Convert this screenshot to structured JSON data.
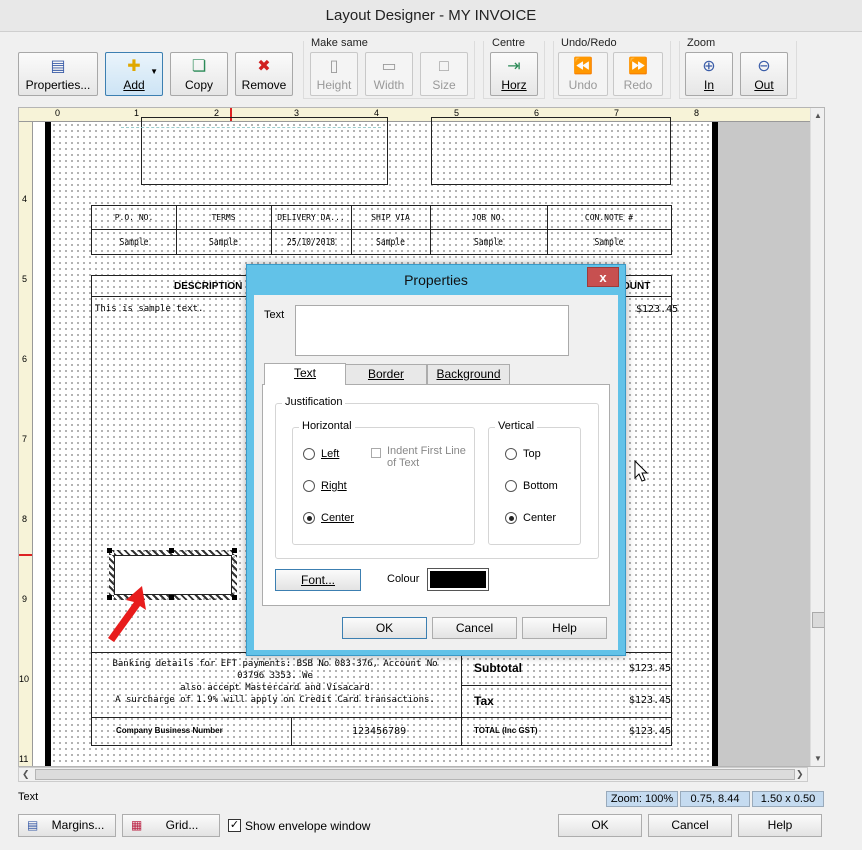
{
  "window": {
    "title": "Layout Designer - MY INVOICE"
  },
  "toolbar": {
    "properties": "Properties...",
    "add": "Add",
    "copy": "Copy",
    "remove": "Remove",
    "make_same_label": "Make same",
    "height": "Height",
    "width": "Width",
    "size": "Size",
    "centre_label": "Centre",
    "horz": "Horz",
    "undo_redo_label": "Undo/Redo",
    "undo": "Undo",
    "redo": "Redo",
    "zoom_label": "Zoom",
    "zoom_in": "In",
    "zoom_out": "Out"
  },
  "ruler": {
    "h": [
      "0",
      "1",
      "2",
      "3",
      "4",
      "5",
      "6",
      "7",
      "8"
    ],
    "v": [
      "4",
      "5",
      "6",
      "7",
      "8",
      "9",
      "10",
      "11"
    ]
  },
  "invoice": {
    "headers": [
      "P.O. NO.",
      "TERMS",
      "DELIVERY DA...",
      "SHIP VIA",
      "JOB NO.",
      "CON.NOTE #"
    ],
    "values": [
      "Sample",
      "Sample",
      "25/10/2018",
      "Sample",
      "Sample",
      "Sample"
    ],
    "description_header": "DESCRIPTION",
    "amount_header": "OUNT",
    "line_text": "This is sample text.",
    "line_amount": "$123.45",
    "bank_line1": "Banking details for EFT payments: BSB No 083-376, Account No 03796 3353. We",
    "bank_line2": "also accept Mastercard and Visacard",
    "bank_line3": "A surcharge of 1.9% will apply on Credit Card transactions.",
    "subtotal_label": "Subtotal",
    "subtotal_value": "$123.45",
    "tax_label": "Tax",
    "tax_value": "$123.45",
    "cbn_label": "Company Business Number",
    "cbn_value": "123456789",
    "total_label": "TOTAL (Inc GST)",
    "total_value": "$123.45"
  },
  "dialog": {
    "title": "Properties",
    "close": "x",
    "text_label": "Text",
    "text_value": "",
    "tabs": [
      "Text",
      "Border",
      "Background"
    ],
    "justification": "Justification",
    "horizontal": "Horizontal",
    "vertical": "Vertical",
    "h_left": "Left",
    "h_right": "Right",
    "h_center": "Center",
    "indent": "Indent First Line of Text",
    "v_top": "Top",
    "v_bottom": "Bottom",
    "v_center": "Center",
    "font_button": "Font...",
    "colour_label": "Colour",
    "colour_value": "#000000",
    "ok": "OK",
    "cancel": "Cancel",
    "help": "Help"
  },
  "status": {
    "left": "Text",
    "zoom": "Zoom: 100%",
    "position": "0.75, 8.44",
    "size": "1.50 x 0.50"
  },
  "bottom": {
    "margins": "Margins...",
    "grid": "Grid...",
    "envelope": "Show envelope window",
    "envelope_checked": true,
    "ok": "OK",
    "cancel": "Cancel",
    "help": "Help"
  },
  "colors": {
    "accent": "#62c2e8",
    "annotation_arrow": "#e81c1c"
  }
}
